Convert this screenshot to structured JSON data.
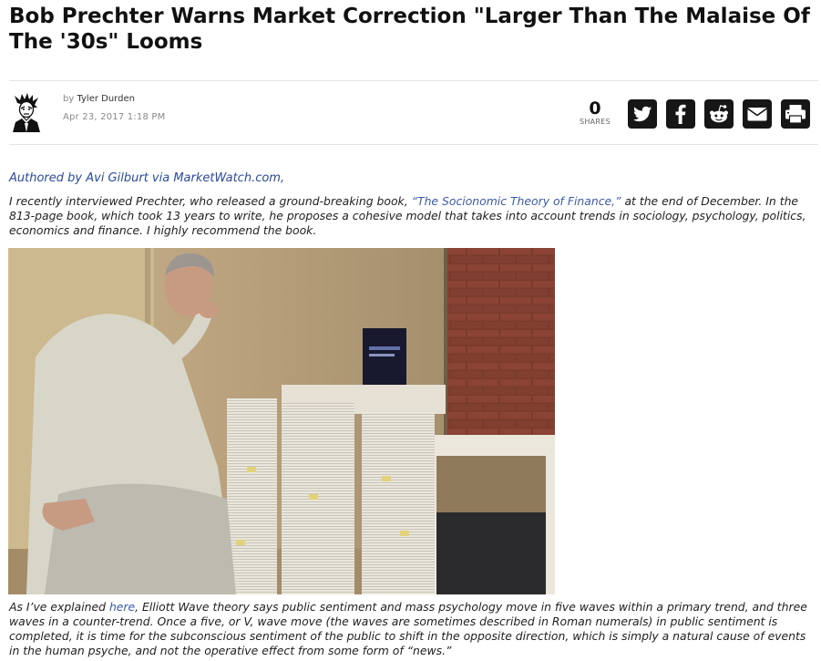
{
  "article": {
    "title": "Bob Prechter Warns Market Correction \"Larger Than The Malaise Of The '30s\" Looms",
    "byline_prefix": "by",
    "author": "Tyler Durden",
    "date": "Apr 23, 2017 1:18 PM"
  },
  "share": {
    "count": "0",
    "label": "SHARES",
    "buttons": [
      {
        "icon": "twitter-icon"
      },
      {
        "icon": "facebook-icon"
      },
      {
        "icon": "reddit-icon"
      },
      {
        "icon": "email-icon"
      },
      {
        "icon": "print-icon"
      }
    ]
  },
  "body": {
    "attribution": "Authored by Avi Gilburt via MarketWatch.com,",
    "para1": {
      "before": "I recently interviewed Prechter, who released a ground-breaking book, ",
      "link": "“The Socionomic Theory of Finance,”",
      "after": " at the end of December. In the 813-page book, which took 13 years to write, he proposes a cohesive model that takes into account trends in sociology, psychology, politics, economics and finance. I highly recommend the book."
    },
    "para2": {
      "before": "As I’ve explained ",
      "link": "here",
      "after": ", Elliott Wave theory says public sentiment and mass psychology move in five waves within a primary trend, and three waves in a counter-trend. Once a five, or V, wave move (the waves are sometimes described in Roman numerals) in public sentiment is completed, it is time for the subconscious sentiment of the public to shift in the opposite direction, which is simply a natural cause of events in the human psyche, and not the operative effect from some form of “news.”"
    }
  },
  "colors": {
    "link": "#3c5aa6",
    "share_button_bg": "#161616",
    "divider": "#e4e4e4"
  }
}
